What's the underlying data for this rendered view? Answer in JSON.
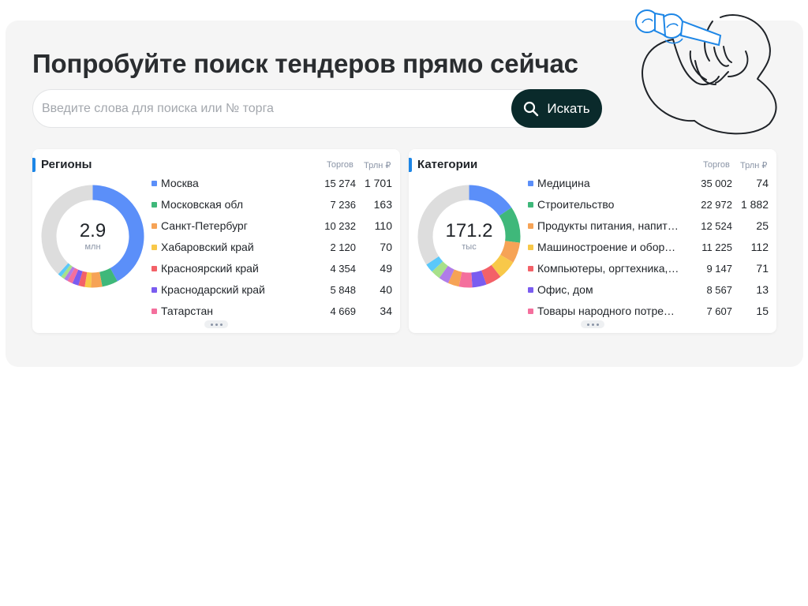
{
  "hero": {
    "title": "Попробуйте поиск тендеров прямо сейчас",
    "search": {
      "placeholder": "Введите слова для поиска или № торга",
      "value": "",
      "button_label": "Искать",
      "button_icon": "search-icon"
    },
    "illustration": "person-with-binoculars"
  },
  "regions": {
    "title": "Регионы",
    "col_count": "Торгов",
    "col_sum": "Трлн ₽",
    "total": "2.9",
    "total_unit": "млн",
    "items": [
      {
        "label": "Москва",
        "count": "15 274",
        "sum": "1 701",
        "color": "#5b8ff9"
      },
      {
        "label": "Московская обл",
        "count": "7 236",
        "sum": "163",
        "color": "#3fb87a"
      },
      {
        "label": "Санкт-Петербург",
        "count": "10 232",
        "sum": "110",
        "color": "#f6a356"
      },
      {
        "label": "Хабаровский край",
        "count": "2 120",
        "sum": "70",
        "color": "#f8c849"
      },
      {
        "label": "Красноярский край",
        "count": "4 354",
        "sum": "49",
        "color": "#f36168"
      },
      {
        "label": "Краснодарский край",
        "count": "5 848",
        "sum": "40",
        "color": "#7a5cf0"
      },
      {
        "label": "Татарстан",
        "count": "4 669",
        "sum": "34",
        "color": "#f46f9d"
      }
    ],
    "donut_slices": [
      {
        "fraction": 0.42,
        "color": "#5b8ff9"
      },
      {
        "fraction": 0.05,
        "color": "#3fb87a"
      },
      {
        "fraction": 0.035,
        "color": "#f6a356"
      },
      {
        "fraction": 0.02,
        "color": "#f8c849"
      },
      {
        "fraction": 0.02,
        "color": "#f36168"
      },
      {
        "fraction": 0.02,
        "color": "#7a5cf0"
      },
      {
        "fraction": 0.017,
        "color": "#f46f9d"
      },
      {
        "fraction": 0.012,
        "color": "#b07de8"
      },
      {
        "fraction": 0.012,
        "color": "#a7e08a"
      },
      {
        "fraction": 0.012,
        "color": "#5ac8fa"
      },
      {
        "fraction": 0.382,
        "color": "#dddddd"
      }
    ]
  },
  "categories": {
    "title": "Категории",
    "col_count": "Торгов",
    "col_sum": "Трлн ₽",
    "total": "171.2",
    "total_unit": "тыс",
    "items": [
      {
        "label": "Медицина",
        "count": "35 002",
        "sum": "74",
        "color": "#5b8ff9"
      },
      {
        "label": "Строительство",
        "count": "22 972",
        "sum": "1 882",
        "color": "#3fb87a"
      },
      {
        "label": "Продукты питания, напитк…",
        "count": "12 524",
        "sum": "25",
        "color": "#f6a356"
      },
      {
        "label": "Машиностроение и оборуд…",
        "count": "11 225",
        "sum": "112",
        "color": "#f8c849"
      },
      {
        "label": "Компьютеры, оргтехника, …",
        "count": "9 147",
        "sum": "71",
        "color": "#f36168"
      },
      {
        "label": "Офис, дом",
        "count": "8 567",
        "sum": "13",
        "color": "#7a5cf0"
      },
      {
        "label": "Товары народного потреб…",
        "count": "7 607",
        "sum": "15",
        "color": "#f46f9d"
      }
    ],
    "donut_slices": [
      {
        "fraction": 0.155,
        "color": "#5b8ff9"
      },
      {
        "fraction": 0.115,
        "color": "#3fb87a"
      },
      {
        "fraction": 0.065,
        "color": "#f6a356"
      },
      {
        "fraction": 0.06,
        "color": "#f8c849"
      },
      {
        "fraction": 0.05,
        "color": "#f36168"
      },
      {
        "fraction": 0.045,
        "color": "#7a5cf0"
      },
      {
        "fraction": 0.042,
        "color": "#f46f9d"
      },
      {
        "fraction": 0.035,
        "color": "#f6a356"
      },
      {
        "fraction": 0.032,
        "color": "#b07de8"
      },
      {
        "fraction": 0.03,
        "color": "#a7e08a"
      },
      {
        "fraction": 0.028,
        "color": "#5ac8fa"
      },
      {
        "fraction": 0.343,
        "color": "#dddddd"
      }
    ]
  }
}
